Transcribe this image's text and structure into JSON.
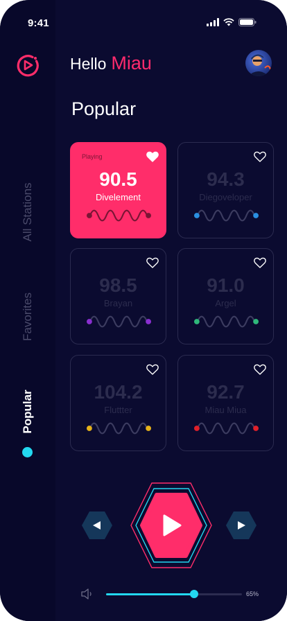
{
  "status_bar": {
    "time": "9:41"
  },
  "sidebar": {
    "items": [
      {
        "label": "All Stations",
        "active": false
      },
      {
        "label": "Favorites",
        "active": false
      },
      {
        "label": "Popular",
        "active": true
      }
    ]
  },
  "header": {
    "hello": "Hello",
    "name": "Miau"
  },
  "section": {
    "title": "Popular"
  },
  "stations": [
    {
      "freq": "90.5",
      "name": "Divelement",
      "playing": true,
      "playing_label": "Playing",
      "color": "#ffffff",
      "favorite": true
    },
    {
      "freq": "94.3",
      "name": "Diegoveloper",
      "playing": false,
      "color": "#2a8fe0",
      "favorite": false
    },
    {
      "freq": "98.5",
      "name": "Brayan",
      "playing": false,
      "color": "#8a2fd0",
      "favorite": false
    },
    {
      "freq": "91.0",
      "name": "Argel",
      "playing": false,
      "color": "#2fb87a",
      "favorite": false
    },
    {
      "freq": "104.2",
      "name": "Fluttter",
      "playing": false,
      "color": "#e6b21a",
      "favorite": false
    },
    {
      "freq": "92.7",
      "name": "Miau Miua",
      "playing": false,
      "color": "#e0202a",
      "favorite": false
    }
  ],
  "player": {
    "prev_icon": "prev-icon",
    "play_icon": "play-icon",
    "next_icon": "next-icon"
  },
  "volume": {
    "level": 0.65,
    "label": "65%"
  },
  "colors": {
    "accent": "#ff2d6a",
    "cyan": "#23d8f0",
    "background": "#0b0b30"
  }
}
